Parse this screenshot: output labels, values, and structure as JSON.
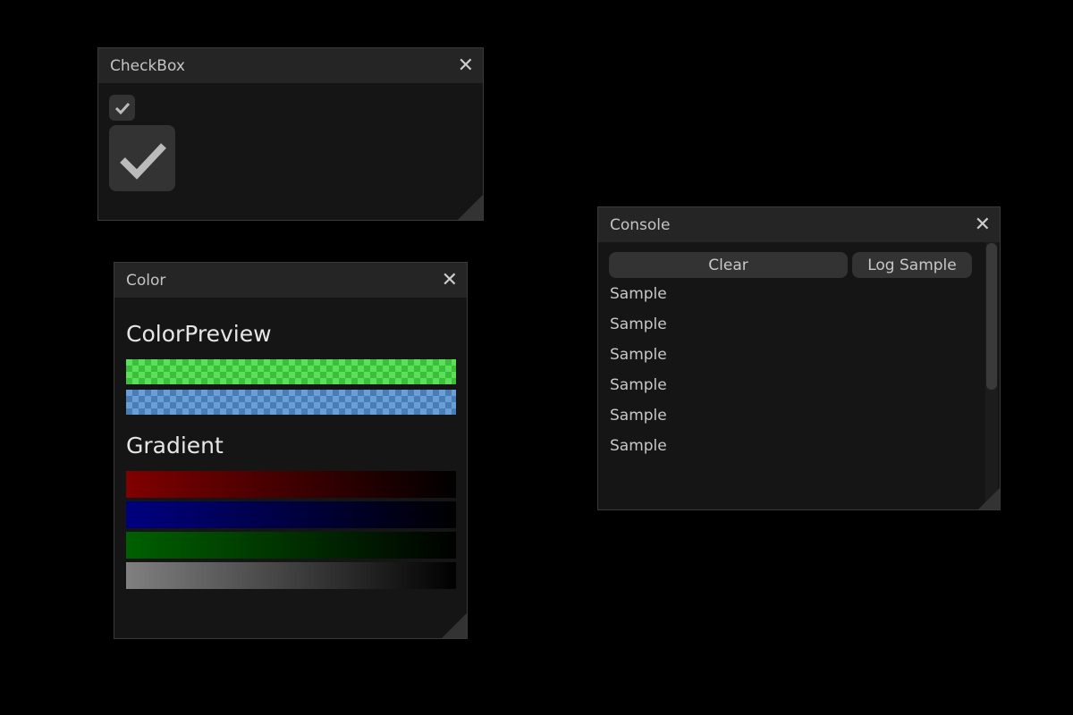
{
  "checkbox_window": {
    "title": "CheckBox",
    "small_checked": true,
    "large_checked": true
  },
  "color_window": {
    "title": "Color",
    "preview_heading": "ColorPreview",
    "preview_colors": [
      "#5ce05c",
      "#6a9ed6"
    ],
    "gradient_heading": "Gradient",
    "gradients": [
      [
        "#800000",
        "#000000"
      ],
      [
        "#000080",
        "#000000"
      ],
      [
        "#006000",
        "#000000"
      ],
      [
        "#808080",
        "#000000"
      ]
    ]
  },
  "console_window": {
    "title": "Console",
    "clear_label": "Clear",
    "log_label": "Log Sample",
    "lines": [
      "Sample",
      "Sample",
      "Sample",
      "Sample",
      "Sample",
      "Sample"
    ]
  }
}
